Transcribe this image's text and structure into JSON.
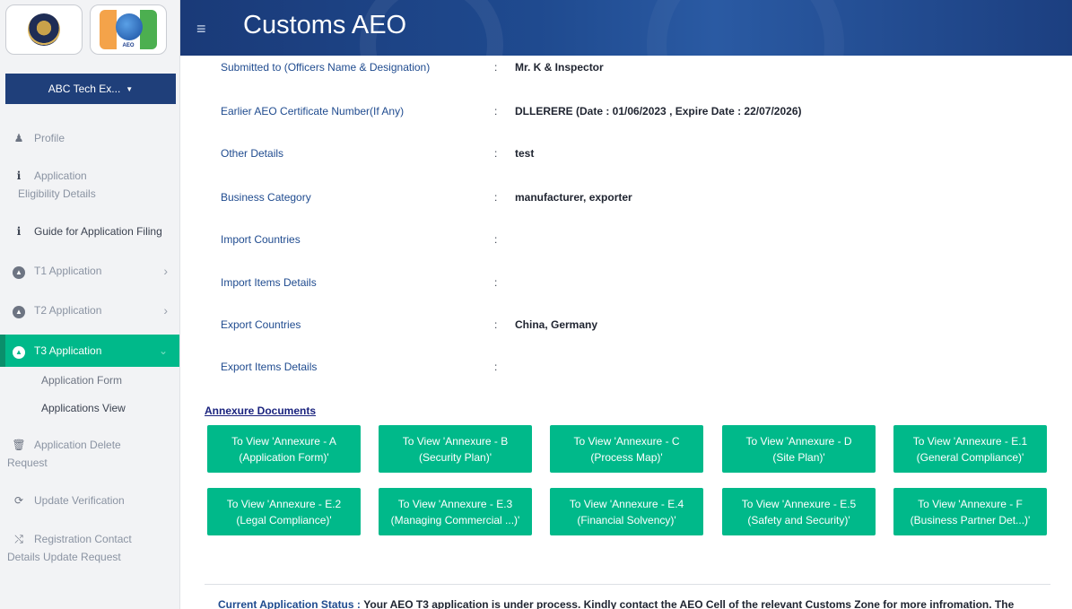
{
  "header": {
    "title": "Customs AEO"
  },
  "logos": {
    "aeo_text": "AEO"
  },
  "sidebar": {
    "account_label": "ABC Tech Ex...",
    "items": [
      {
        "label": "Profile",
        "icon": "user-icon"
      },
      {
        "label": "Application",
        "label2": "Eligibility Details",
        "icon": "info-icon"
      },
      {
        "label": "Guide for Application Filing",
        "icon": "info-icon"
      },
      {
        "label": "T1 Application",
        "icon": "circle-icon"
      },
      {
        "label": "T2 Application",
        "icon": "circle-icon"
      },
      {
        "label": "T3 Application",
        "icon": "circle-icon"
      },
      {
        "label": "Application Delete",
        "label2": "Request",
        "icon": "trash-icon"
      },
      {
        "label": "Update Verification",
        "icon": "sync-icon"
      },
      {
        "label": "Registration Contact",
        "label2": "Details Update Request",
        "icon": "shuffle-icon"
      }
    ],
    "subitems": [
      "Application Form",
      "Applications View"
    ]
  },
  "details": [
    {
      "label": "Submitted to (Officers Name & Designation)",
      "value": "Mr. K & Inspector"
    },
    {
      "label": "Earlier AEO Certificate Number(If Any)",
      "value": "DLLERERE (Date : 01/06/2023 , Expire Date : 22/07/2026)"
    },
    {
      "label": "Other Details",
      "value": "test"
    },
    {
      "label": "Business Category",
      "value": "manufacturer, exporter"
    },
    {
      "label": "Import Countries",
      "value": ""
    },
    {
      "label": "Import Items Details",
      "value": ""
    },
    {
      "label": "Export Countries",
      "value": "China, Germany"
    },
    {
      "label": "Export Items Details",
      "value": ""
    }
  ],
  "annexure": {
    "title": "Annexure Documents",
    "buttons": [
      {
        "line1": "To View 'Annexure - A",
        "line2": "(Application Form)'"
      },
      {
        "line1": "To View 'Annexure - B",
        "line2": "(Security Plan)'"
      },
      {
        "line1": "To View 'Annexure - C",
        "line2": "(Process Map)'"
      },
      {
        "line1": "To View 'Annexure - D",
        "line2": "(Site Plan)'"
      },
      {
        "line1": "To View 'Annexure - E.1",
        "line2": "(General Compliance)'"
      },
      {
        "line1": "To View 'Annexure - E.2",
        "line2": "(Legal Compliance)'"
      },
      {
        "line1": "To View 'Annexure - E.3",
        "line2": "(Managing Commercial ...)'"
      },
      {
        "line1": "To View 'Annexure - E.4",
        "line2": "(Financial Solvency)'"
      },
      {
        "line1": "To View 'Annexure - E.5",
        "line2": "(Safety and Security)'"
      },
      {
        "line1": "To View 'Annexure - F",
        "line2": "(Business Partner Det...)'"
      }
    ]
  },
  "status": {
    "label": "Current Application Status :",
    "text": "Your AEO T3 application is under process. Kindly contact the AEO Cell of the relevant Customs Zone for more infromation. The"
  }
}
